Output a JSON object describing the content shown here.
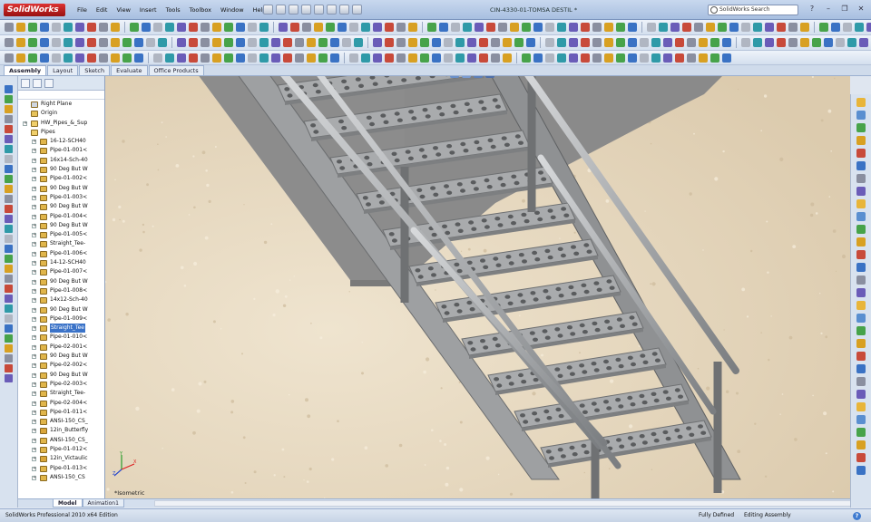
{
  "app": {
    "logo": "SolidWorks",
    "document_title": "CIN-4330-01-TOMSA DESTIL *",
    "menus": [
      "File",
      "Edit",
      "View",
      "Insert",
      "Tools",
      "Toolbox",
      "Window",
      "Help"
    ],
    "search_placeholder": "SolidWorks Search"
  },
  "tabs": [
    {
      "label": "Assembly",
      "active": true
    },
    {
      "label": "Layout",
      "active": false
    },
    {
      "label": "Sketch",
      "active": false
    },
    {
      "label": "Evaluate",
      "active": false
    },
    {
      "label": "Office Products",
      "active": false
    }
  ],
  "tree": {
    "items": [
      {
        "label": "Right Plane",
        "depth": 1,
        "icon": "plane-icon",
        "expander": false
      },
      {
        "label": "Origin",
        "depth": 1,
        "icon": "origin-icon",
        "expander": false
      },
      {
        "label": "HW_Pipes_&_Sup",
        "depth": 1,
        "icon": "folder-icon",
        "expander": true
      },
      {
        "label": "Pipes",
        "depth": 1,
        "icon": "folder-icon",
        "expander": false
      },
      {
        "label": "16-12-SCH40",
        "depth": 2,
        "icon": "part-icon",
        "expander": true
      },
      {
        "label": "Pipe-01-001<",
        "depth": 2,
        "icon": "part-icon",
        "expander": true
      },
      {
        "label": "16x14-Sch-40",
        "depth": 2,
        "icon": "part-icon",
        "expander": true
      },
      {
        "label": "90 Deg But W",
        "depth": 2,
        "icon": "part-icon",
        "expander": true
      },
      {
        "label": "Pipe-01-002<",
        "depth": 2,
        "icon": "part-icon",
        "expander": true
      },
      {
        "label": "90 Deg But W",
        "depth": 2,
        "icon": "part-icon",
        "expander": true
      },
      {
        "label": "Pipe-01-003<",
        "depth": 2,
        "icon": "part-icon",
        "expander": true
      },
      {
        "label": "90 Deg But W",
        "depth": 2,
        "icon": "part-icon",
        "expander": true
      },
      {
        "label": "Pipe-01-004<",
        "depth": 2,
        "icon": "part-icon",
        "expander": true
      },
      {
        "label": "90 Deg But W",
        "depth": 2,
        "icon": "part-icon",
        "expander": true
      },
      {
        "label": "Pipe-01-005<",
        "depth": 2,
        "icon": "part-icon",
        "expander": true
      },
      {
        "label": "Straight_Tee-",
        "depth": 2,
        "icon": "part-icon",
        "expander": true
      },
      {
        "label": "Pipe-01-006<",
        "depth": 2,
        "icon": "part-icon",
        "expander": true
      },
      {
        "label": "14-12-SCH40",
        "depth": 2,
        "icon": "part-icon",
        "expander": true
      },
      {
        "label": "Pipe-01-007<",
        "depth": 2,
        "icon": "part-icon",
        "expander": true
      },
      {
        "label": "90 Deg But W",
        "depth": 2,
        "icon": "part-icon",
        "expander": true
      },
      {
        "label": "Pipe-01-008<",
        "depth": 2,
        "icon": "part-icon",
        "expander": true
      },
      {
        "label": "14x12-Sch-40",
        "depth": 2,
        "icon": "part-icon",
        "expander": true
      },
      {
        "label": "90 Deg But W",
        "depth": 2,
        "icon": "part-icon",
        "expander": true
      },
      {
        "label": "Pipe-01-009<",
        "depth": 2,
        "icon": "part-icon",
        "expander": true
      },
      {
        "label": "Straight_Tee",
        "depth": 2,
        "icon": "part-icon",
        "expander": true,
        "selected": true
      },
      {
        "label": "Pipe-01-010<",
        "depth": 2,
        "icon": "part-icon",
        "expander": true
      },
      {
        "label": "Pipe-02-001<",
        "depth": 2,
        "icon": "part-icon",
        "expander": true
      },
      {
        "label": "90 Deg But W",
        "depth": 2,
        "icon": "part-icon",
        "expander": true
      },
      {
        "label": "Pipe-02-002<",
        "depth": 2,
        "icon": "part-icon",
        "expander": true
      },
      {
        "label": "90 Deg But W",
        "depth": 2,
        "icon": "part-icon",
        "expander": true
      },
      {
        "label": "Pipe-02-003<",
        "depth": 2,
        "icon": "part-icon",
        "expander": true
      },
      {
        "label": "Straight_Tee-",
        "depth": 2,
        "icon": "part-icon",
        "expander": true
      },
      {
        "label": "Pipe-02-004<",
        "depth": 2,
        "icon": "part-icon",
        "expander": true
      },
      {
        "label": "Pipe-01-011<",
        "depth": 2,
        "icon": "part-icon",
        "expander": true
      },
      {
        "label": "ANSI-150_CS_",
        "depth": 2,
        "icon": "part-icon",
        "expander": true
      },
      {
        "label": "12in_Butterfly",
        "depth": 2,
        "icon": "assembly-icon",
        "expander": true
      },
      {
        "label": "ANSI-150_CS_",
        "depth": 2,
        "icon": "part-icon",
        "expander": true
      },
      {
        "label": "Pipe-01-012<",
        "depth": 2,
        "icon": "part-icon",
        "expander": true
      },
      {
        "label": "12in_Victaulic",
        "depth": 2,
        "icon": "assembly-icon",
        "expander": true
      },
      {
        "label": "Pipe-01-013<",
        "depth": 2,
        "icon": "part-icon",
        "expander": true
      },
      {
        "label": "ANSI-150_CS",
        "depth": 2,
        "icon": "part-icon",
        "expander": true
      }
    ]
  },
  "viewport": {
    "view_name": "*Isometric"
  },
  "bottom_tabs": [
    {
      "label": "Model",
      "active": true
    },
    {
      "label": "Animation1",
      "active": false
    }
  ],
  "status": {
    "product": "SolidWorks Professional 2010 x64 Edition",
    "definition": "Fully Defined",
    "mode": "Editing Assembly",
    "help": "?"
  },
  "colors": {
    "floor": "#e9dcc4",
    "wall_front": "#8b8b8b",
    "wall_top": "#a6a6a6",
    "steel": "#9a9c9e",
    "selection": "#3b73c8",
    "logo_red": "#cc2222"
  }
}
